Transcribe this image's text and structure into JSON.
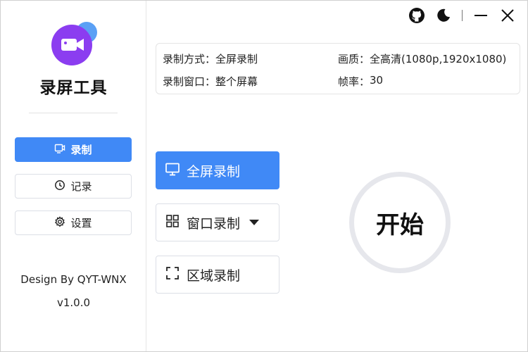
{
  "app": {
    "name": "录屏工具",
    "credit": "Design By QYT-WNX",
    "version": "v1.0.0"
  },
  "colors": {
    "accent": "#4089f6",
    "logo_purple": "#8b3df0",
    "logo_blue": "#5aa0f5"
  },
  "sidebar": {
    "items": [
      {
        "label": "录制",
        "icon": "record-screen-icon",
        "active": true
      },
      {
        "label": "记录",
        "icon": "clock-icon",
        "active": false
      },
      {
        "label": "设置",
        "icon": "gear-icon",
        "active": false
      }
    ]
  },
  "titlebar": {
    "icons": [
      "github-icon",
      "moon-icon",
      "minimize-icon",
      "close-icon"
    ]
  },
  "info": {
    "mode_label": "录制方式：",
    "mode_value": "全屏录制",
    "quality_label": "画质：",
    "quality_value": "全高清(1080p,1920x1080)",
    "window_label": "录制窗口：",
    "window_value": "整个屏幕",
    "fps_label": "帧率：",
    "fps_value": "30"
  },
  "modes": {
    "fullscreen": "全屏录制",
    "window": "窗口录制",
    "region": "区域录制"
  },
  "start": {
    "label": "开始"
  }
}
